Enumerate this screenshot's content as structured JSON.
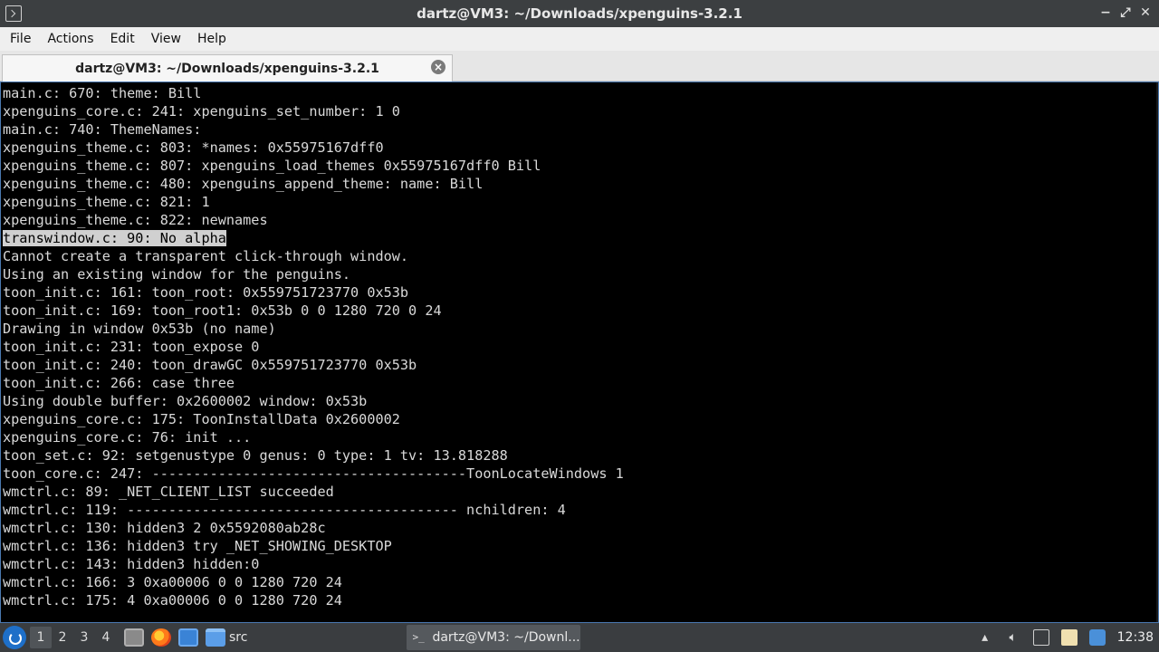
{
  "window": {
    "title": "dartz@VM3: ~/Downloads/xpenguins-3.2.1",
    "controls": {
      "minimize": "−",
      "maximize": "⤢",
      "close": "✕"
    }
  },
  "menu": [
    "File",
    "Actions",
    "Edit",
    "View",
    "Help"
  ],
  "tab": {
    "title": "dartz@VM3: ~/Downloads/xpenguins-3.2.1",
    "close": "×"
  },
  "terminal": {
    "lines": [
      "main.c: 670: theme: Bill",
      "xpenguins_core.c: 241: xpenguins_set_number: 1 0",
      "main.c: 740: ThemeNames:",
      "xpenguins_theme.c: 803: *names: 0x55975167dff0",
      "xpenguins_theme.c: 807: xpenguins_load_themes 0x55975167dff0 Bill",
      "xpenguins_theme.c: 480: xpenguins_append_theme: name: Bill",
      "xpenguins_theme.c: 821: 1",
      "xpenguins_theme.c: 822: newnames",
      "transwindow.c: 90: No alpha",
      "Cannot create a transparent click-through window.",
      "Using an existing window for the penguins.",
      "toon_init.c: 161: toon_root: 0x559751723770 0x53b",
      "toon_init.c: 169: toon_root1: 0x53b 0 0 1280 720 0 24",
      "Drawing in window 0x53b (no name)",
      "toon_init.c: 231: toon_expose 0",
      "toon_init.c: 240: toon_drawGC 0x559751723770 0x53b",
      "toon_init.c: 266: case three",
      "Using double buffer: 0x2600002 window: 0x53b",
      "xpenguins_core.c: 175: ToonInstallData 0x2600002",
      "xpenguins_core.c: 76: init ...",
      "toon_set.c: 92: setgenustype 0 genus: 0 type: 1 tv: 13.818288",
      "toon_core.c: 247: --------------------------------------ToonLocateWindows 1",
      "wmctrl.c: 89: _NET_CLIENT_LIST succeeded",
      "wmctrl.c: 119: ---------------------------------------- nchildren: 4",
      "wmctrl.c: 130: hidden3 2 0x5592080ab28c",
      "wmctrl.c: 136: hidden3 try _NET_SHOWING_DESKTOP",
      "wmctrl.c: 143: hidden3 hidden:0",
      "wmctrl.c: 166: 3 0xa00006 0 0 1280 720 24",
      "wmctrl.c: 175: 4 0xa00006 0 0 1280 720 24"
    ],
    "selected_line_index": 8
  },
  "taskbar": {
    "workspaces": [
      "1",
      "2",
      "3",
      "4"
    ],
    "active_workspace": "1",
    "launchers": [
      "files-icon",
      "firefox-icon",
      "show-desktop-icon",
      "folder-icon"
    ],
    "folder_label": "src",
    "window_button": "dartz@VM3: ~/Downl...",
    "tray": [
      "notification-icon",
      "volume-icon",
      "display-icon",
      "clipboard-icon",
      "network-icon"
    ],
    "clock": "12:38"
  }
}
